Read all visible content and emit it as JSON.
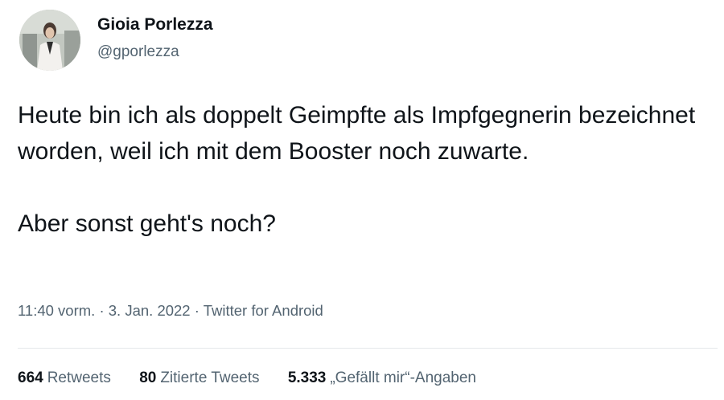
{
  "author": {
    "name": "Gioia Porlezza",
    "handle": "@gporlezza"
  },
  "tweet": {
    "paragraph1": "Heute bin ich als doppelt Geimpfte als Impfgegnerin bezeichnet worden, weil ich mit dem Booster noch zuwarte.",
    "paragraph2": "Aber sonst geht's noch?"
  },
  "meta": {
    "time": "11:40 vorm.",
    "separator": "·",
    "date": "3. Jan. 2022",
    "source": "Twitter for Android"
  },
  "stats": [
    {
      "count": "664",
      "label": "Retweets"
    },
    {
      "count": "80",
      "label": "Zitierte Tweets"
    },
    {
      "count": "5.333",
      "label": "„Gefällt mir“-Angaben"
    }
  ],
  "colors": {
    "text": "#0f1419",
    "secondary": "#536471",
    "divider": "#e5e8ea"
  }
}
